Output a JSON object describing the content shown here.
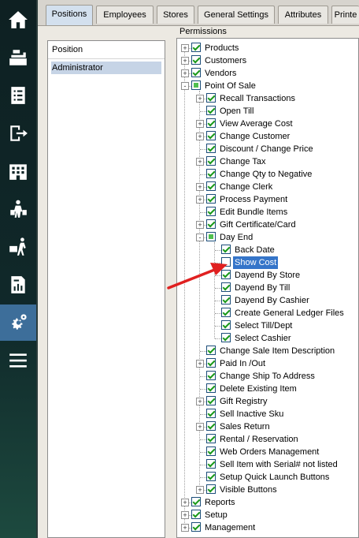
{
  "tabs": [
    {
      "label": "Positions",
      "active": true
    },
    {
      "label": "Employees",
      "active": false
    },
    {
      "label": "Stores",
      "active": false
    },
    {
      "label": "General Settings",
      "active": false
    },
    {
      "label": "Attributes",
      "active": false
    },
    {
      "label": "Printe",
      "active": false
    }
  ],
  "position_panel": {
    "header": "Position",
    "selected": "Administrator"
  },
  "permissions": {
    "label": "Permissions",
    "nodes": [
      {
        "label": "Products",
        "level": 0,
        "state": "checked",
        "expander": "+"
      },
      {
        "label": "Customers",
        "level": 0,
        "state": "checked",
        "expander": "+"
      },
      {
        "label": "Vendors",
        "level": 0,
        "state": "checked",
        "expander": "+"
      },
      {
        "label": "Point Of Sale",
        "level": 0,
        "state": "partial",
        "expander": "-"
      },
      {
        "label": "Recall Transactions",
        "level": 1,
        "state": "checked",
        "expander": "+"
      },
      {
        "label": "Open Till",
        "level": 1,
        "state": "checked",
        "expander": ""
      },
      {
        "label": "View Average Cost",
        "level": 1,
        "state": "checked",
        "expander": "+"
      },
      {
        "label": "Change Customer",
        "level": 1,
        "state": "checked",
        "expander": "+"
      },
      {
        "label": "Discount / Change Price",
        "level": 1,
        "state": "checked",
        "expander": ""
      },
      {
        "label": "Change Tax",
        "level": 1,
        "state": "checked",
        "expander": "+"
      },
      {
        "label": "Change Qty to Negative",
        "level": 1,
        "state": "checked",
        "expander": ""
      },
      {
        "label": "Change Clerk",
        "level": 1,
        "state": "checked",
        "expander": "+"
      },
      {
        "label": "Process Payment",
        "level": 1,
        "state": "checked",
        "expander": "+"
      },
      {
        "label": "Edit Bundle Items",
        "level": 1,
        "state": "checked",
        "expander": ""
      },
      {
        "label": "Gift Certificate/Card",
        "level": 1,
        "state": "checked",
        "expander": "+"
      },
      {
        "label": "Day End",
        "level": 1,
        "state": "partial",
        "expander": "-"
      },
      {
        "label": "Back Date",
        "level": 2,
        "state": "checked",
        "expander": ""
      },
      {
        "label": "Show Cost",
        "level": 2,
        "state": "unchecked",
        "expander": "",
        "selected": true
      },
      {
        "label": "Dayend By Store",
        "level": 2,
        "state": "checked",
        "expander": ""
      },
      {
        "label": "Dayend By Till",
        "level": 2,
        "state": "checked",
        "expander": ""
      },
      {
        "label": "Dayend By Cashier",
        "level": 2,
        "state": "checked",
        "expander": ""
      },
      {
        "label": "Create General Ledger Files",
        "level": 2,
        "state": "checked",
        "expander": ""
      },
      {
        "label": "Select Till/Dept",
        "level": 2,
        "state": "checked",
        "expander": ""
      },
      {
        "label": "Select Cashier",
        "level": 2,
        "state": "checked",
        "expander": ""
      },
      {
        "label": "Change Sale Item Description",
        "level": 1,
        "state": "checked",
        "expander": ""
      },
      {
        "label": "Paid In /Out",
        "level": 1,
        "state": "checked",
        "expander": "+"
      },
      {
        "label": "Change Ship To Address",
        "level": 1,
        "state": "checked",
        "expander": ""
      },
      {
        "label": "Delete Existing Item",
        "level": 1,
        "state": "checked",
        "expander": ""
      },
      {
        "label": "Gift Registry",
        "level": 1,
        "state": "checked",
        "expander": "+"
      },
      {
        "label": "Sell Inactive Sku",
        "level": 1,
        "state": "checked",
        "expander": ""
      },
      {
        "label": "Sales Return",
        "level": 1,
        "state": "checked",
        "expander": "+"
      },
      {
        "label": "Rental / Reservation",
        "level": 1,
        "state": "checked",
        "expander": ""
      },
      {
        "label": "Web Orders Management",
        "level": 1,
        "state": "checked",
        "expander": ""
      },
      {
        "label": "Sell Item with Serial# not listed",
        "level": 1,
        "state": "checked",
        "expander": ""
      },
      {
        "label": "Setup Quick Launch Buttons",
        "level": 1,
        "state": "checked",
        "expander": ""
      },
      {
        "label": "Visible Buttons",
        "level": 1,
        "state": "checked",
        "expander": "+"
      },
      {
        "label": "Reports",
        "level": 0,
        "state": "checked",
        "expander": "+"
      },
      {
        "label": "Setup",
        "level": 0,
        "state": "checked",
        "expander": "+"
      },
      {
        "label": "Management",
        "level": 0,
        "state": "checked",
        "expander": "+"
      }
    ]
  },
  "sidebar": {
    "icons": [
      "home-icon",
      "cash-register-icon",
      "receipt-icon",
      "exit-icon",
      "building-icon",
      "shopper-icon",
      "delivery-icon",
      "report-icon",
      "gears-icon",
      "menu-icon"
    ],
    "active_index": 8
  },
  "colors": {
    "selection": "#3575c9",
    "check": "#1a9a1a",
    "arrow": "#e02020",
    "sidebar_active": "#3d6e9a"
  }
}
